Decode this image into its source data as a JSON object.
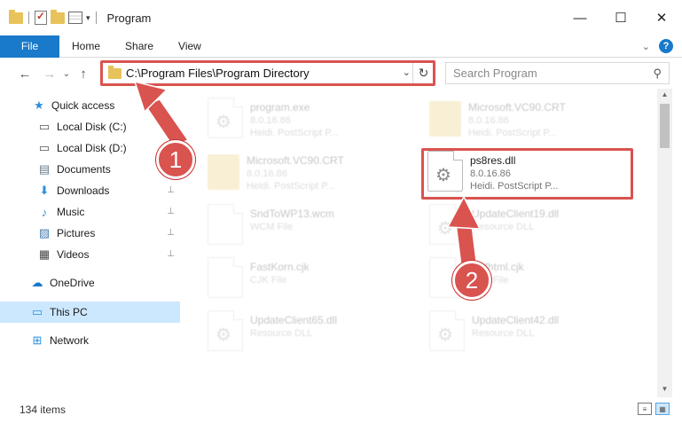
{
  "window": {
    "title": "Program",
    "minimize": "—",
    "maximize": "☐",
    "close": "✕"
  },
  "ribbon": {
    "tabs": [
      "File",
      "Home",
      "Share",
      "View"
    ],
    "collapse_glyph": "⌄",
    "help_glyph": "?"
  },
  "nav": {
    "back_glyph": "←",
    "forward_glyph": "→",
    "recent_glyph": "⌄",
    "up_glyph": "↑",
    "address": "C:\\Program Files\\Program Directory",
    "address_drop_glyph": "⌄",
    "refresh_glyph": "↻",
    "search_placeholder": "Search Program",
    "search_glyph": "⚲"
  },
  "sidebar": {
    "items": [
      {
        "label": "Quick access",
        "icon": "star-icon",
        "glyph": "★",
        "color": "#2d8fdd",
        "pinned": false
      },
      {
        "label": "Local Disk (C:)",
        "icon": "drive-icon",
        "glyph": "▭",
        "color": "#555555",
        "pinned": true
      },
      {
        "label": "Local Disk (D:)",
        "icon": "drive-icon",
        "glyph": "▭",
        "color": "#555555",
        "pinned": true
      },
      {
        "label": "Documents",
        "icon": "documents-icon",
        "glyph": "▤",
        "color": "#6a7b8c",
        "pinned": true
      },
      {
        "label": "Downloads",
        "icon": "download-icon",
        "glyph": "⬇",
        "color": "#2d8fdd",
        "pinned": true
      },
      {
        "label": "Music",
        "icon": "music-icon",
        "glyph": "♪",
        "color": "#2d8fdd",
        "pinned": true
      },
      {
        "label": "Pictures",
        "icon": "pictures-icon",
        "glyph": "▨",
        "color": "#4a7fb0",
        "pinned": true
      },
      {
        "label": "Videos",
        "icon": "videos-icon",
        "glyph": "▦",
        "color": "#444444",
        "pinned": true
      },
      {
        "label": "OneDrive",
        "icon": "cloud-icon",
        "glyph": "☁",
        "color": "#1979ca",
        "pinned": false
      },
      {
        "label": "This PC",
        "icon": "computer-icon",
        "glyph": "▭",
        "color": "#2d8fdd",
        "pinned": false,
        "selected": true
      },
      {
        "label": "Network",
        "icon": "network-icon",
        "glyph": "⊞",
        "color": "#2d8fdd",
        "pinned": false
      }
    ],
    "pin_glyph": "📌"
  },
  "files": [
    {
      "name": "program.exe",
      "line1": "8.0.16.86",
      "line2": "Heidi. PostScript P...",
      "kind": "exe",
      "faded": true
    },
    {
      "name": "Microsoft.VC90.CRT",
      "line1": "8.0.16.86",
      "line2": "Heidi. PostScript P...",
      "kind": "folder",
      "faded": true
    },
    {
      "name": "Microsoft.VC90.CRT",
      "line1": "8.0.16.86",
      "line2": "Heidi. PostScript P...",
      "kind": "folder",
      "faded": true
    },
    {
      "name": "ps8res.dll",
      "line1": "8.0.16.86",
      "line2": "Heidi. PostScript P...",
      "kind": "dll",
      "faded": false
    },
    {
      "name": "SndToWP13.wcm",
      "line1": "WCM File",
      "line2": "",
      "kind": "doc",
      "faded": true
    },
    {
      "name": "UpdateClient19.dll",
      "line1": "Resource DLL",
      "line2": "",
      "kind": "dll",
      "faded": true
    },
    {
      "name": "FastKorn.cjk",
      "line1": "CJK File",
      "line2": "",
      "kind": "doc",
      "faded": true
    },
    {
      "name": "Pdfhtml.cjk",
      "line1": "CJK File",
      "line2": "",
      "kind": "doc",
      "faded": true
    },
    {
      "name": "UpdateClient65.dll",
      "line1": "Resource DLL",
      "line2": "",
      "kind": "dll",
      "faded": true
    },
    {
      "name": "UpdateClient42.dll",
      "line1": "Resource DLL",
      "line2": "",
      "kind": "dll",
      "faded": true
    }
  ],
  "status": {
    "item_count": "134 items"
  },
  "callouts": {
    "step1": "1",
    "step2": "2",
    "color": "#d9534f"
  },
  "scrollbar": {
    "up_glyph": "▲",
    "down_glyph": "▼"
  }
}
